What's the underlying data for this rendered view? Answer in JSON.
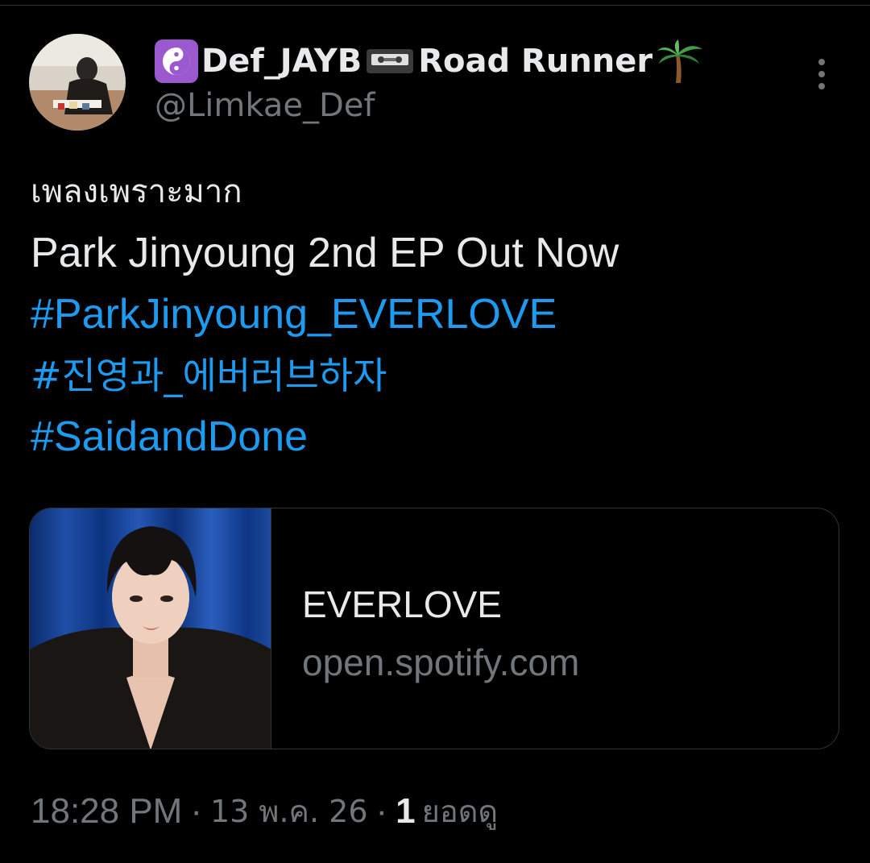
{
  "tweet": {
    "author": {
      "display_name": "Def_JAYB",
      "display_name_suffix": "Road Runner",
      "handle": "@Limkae_Def",
      "emoji": [
        "yin-yang",
        "videocassette",
        "palm-tree"
      ]
    },
    "lines": [
      "เพลงเพราะมาก",
      "Park Jinyoung 2nd EP Out Now"
    ],
    "hashtags": [
      "#ParkJinyoung_EVERLOVE",
      "#진영과_에버러브하자",
      "#SaidandDone"
    ],
    "card": {
      "title": "EVERLOVE",
      "domain": "open.spotify.com"
    },
    "meta": {
      "time": "18:28 PM",
      "date": "13 พ.ค. 26",
      "separator": "·",
      "views_count": "1",
      "views_label": "ยอดดู"
    }
  },
  "colors": {
    "background": "#000000",
    "text": "#e7e9ea",
    "secondary": "#71767b",
    "link": "#1d9bf0",
    "border": "#2f3336"
  }
}
